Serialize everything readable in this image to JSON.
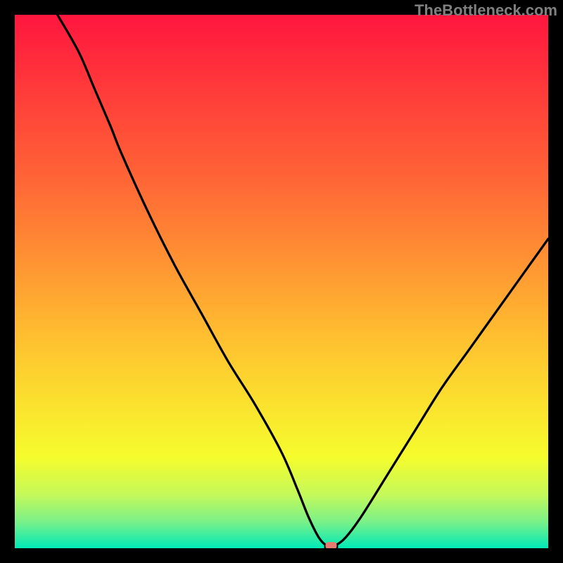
{
  "watermark": "TheBottleneck.com",
  "chart_data": {
    "type": "line",
    "title": "",
    "xlabel": "",
    "ylabel": "",
    "xlim": [
      0,
      100
    ],
    "ylim": [
      0,
      100
    ],
    "x": [
      8,
      12,
      15,
      18,
      20,
      25,
      30,
      35,
      40,
      45,
      50,
      53,
      55,
      57,
      58.5,
      60,
      62,
      65,
      70,
      75,
      80,
      85,
      90,
      95,
      100
    ],
    "y": [
      100,
      93,
      86,
      79,
      74,
      63,
      53,
      44,
      35,
      27,
      18,
      11,
      6,
      2,
      0.5,
      0.5,
      2,
      6,
      14,
      22,
      30,
      37,
      44,
      51,
      58
    ],
    "marker": {
      "x": 59.3,
      "y": 0.5
    },
    "notch": {
      "xmin": 58,
      "xmax": 60.6,
      "y": 0
    },
    "background_gradient": {
      "stops": [
        {
          "pos": 0.0,
          "color": "#ff163e"
        },
        {
          "pos": 0.15,
          "color": "#ff3d3a"
        },
        {
          "pos": 0.3,
          "color": "#ff6336"
        },
        {
          "pos": 0.45,
          "color": "#ff8f33"
        },
        {
          "pos": 0.6,
          "color": "#ffbe30"
        },
        {
          "pos": 0.75,
          "color": "#fae72e"
        },
        {
          "pos": 0.83,
          "color": "#f5fc2d"
        },
        {
          "pos": 0.9,
          "color": "#c4f95a"
        },
        {
          "pos": 0.95,
          "color": "#7bf188"
        },
        {
          "pos": 1.0,
          "color": "#00e9b8"
        }
      ]
    }
  }
}
